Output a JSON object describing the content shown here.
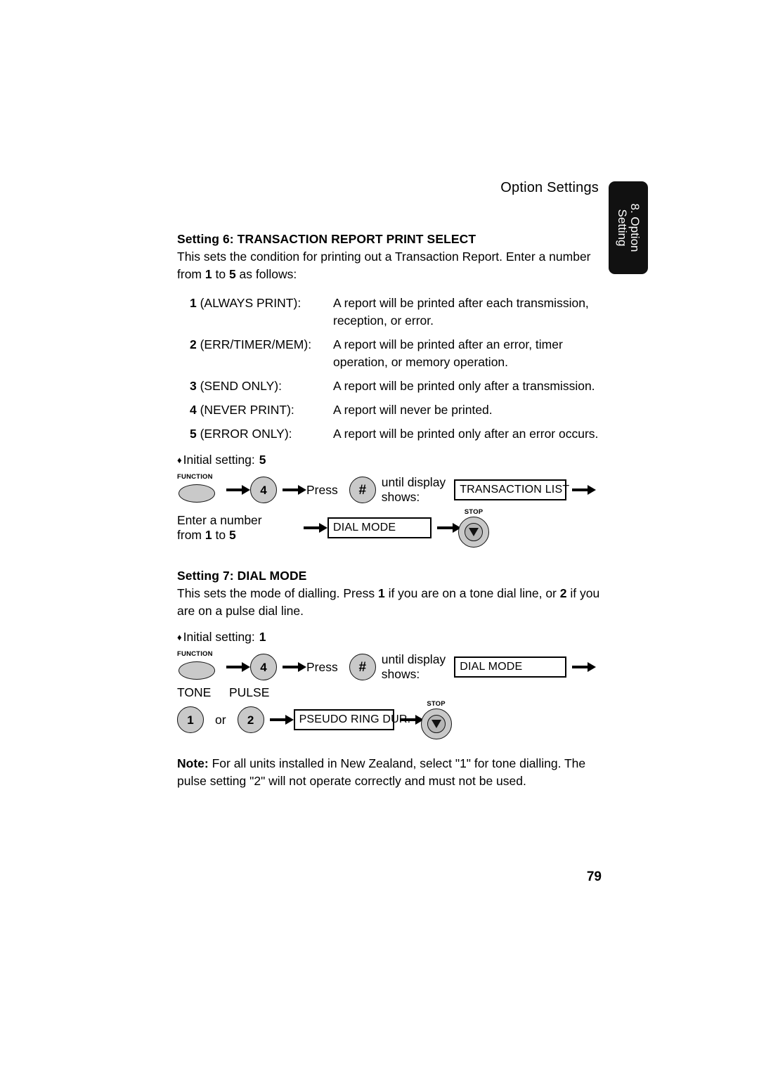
{
  "header": {
    "running_title": "Option Settings"
  },
  "chapter_tab": {
    "line1": "8. Option",
    "line2": "Setting",
    "background": "#111111",
    "text_color": "#ffffff"
  },
  "section6": {
    "title": "Setting 6: TRANSACTION REPORT PRINT SELECT",
    "intro_part1": "This sets the condition for printing out a Transaction Report. Enter a number from ",
    "intro_bold1": "1",
    "intro_part2": " to ",
    "intro_bold2": "5",
    "intro_part3": " as follows:",
    "options": [
      {
        "num": "1",
        "name": "(ALWAYS PRINT):",
        "desc": "A report will be printed after each transmission, reception, or error."
      },
      {
        "num": "2",
        "name": "(ERR/TIMER/MEM):",
        "desc": "A report will be printed after an error, timer operation, or memory operation."
      },
      {
        "num": "3",
        "name": "(SEND ONLY):",
        "desc": "A report will be printed only after a transmission."
      },
      {
        "num": "4",
        "name": "(NEVER PRINT):",
        "desc": "A report will never be printed."
      },
      {
        "num": "5",
        "name": "(ERROR ONLY):",
        "desc": "A report will be printed only after an error occurs."
      }
    ],
    "initial_label": "Initial setting:",
    "initial_value": "5",
    "bullet": "♦",
    "procedure": {
      "function_key_caption": "FUNCTION",
      "key_4": "4",
      "press_label": "Press",
      "key_hash": "#",
      "until_line1": "until display",
      "until_line2": "shows:",
      "display_1": "TRANSACTION LIST",
      "enter_line1": "Enter a number",
      "enter_line2_pre": "from ",
      "enter_line2_a": "1",
      "enter_line2_mid": " to ",
      "enter_line2_b": "5",
      "display_2": "DIAL MODE",
      "stop_caption": "STOP"
    }
  },
  "section7": {
    "title": "Setting 7: DIAL MODE",
    "intro_part1": "This sets the mode of dialling. Press ",
    "intro_bold1": "1",
    "intro_part2": " if you are on a tone dial line, or ",
    "intro_bold2": "2",
    "intro_part3": " if you are on a pulse dial line.",
    "initial_label": "Initial setting:",
    "initial_value": "1",
    "bullet": "♦",
    "procedure": {
      "function_key_caption": "FUNCTION",
      "key_4": "4",
      "press_label": "Press",
      "key_hash": "#",
      "until_line1": "until display",
      "until_line2": "shows:",
      "display_1": "DIAL MODE",
      "tone_label": "TONE",
      "pulse_label": "PULSE",
      "key_1": "1",
      "or_label": "or",
      "key_2": "2",
      "display_2": "PSEUDO RING DUR.",
      "stop_caption": "STOP"
    },
    "note_bold": "Note:",
    "note_text": " For all units installed in New Zealand, select \"1\" for tone dialling. The pulse setting \"2\" will not operate correctly and must not be used."
  },
  "footer": {
    "page_number": "79"
  }
}
